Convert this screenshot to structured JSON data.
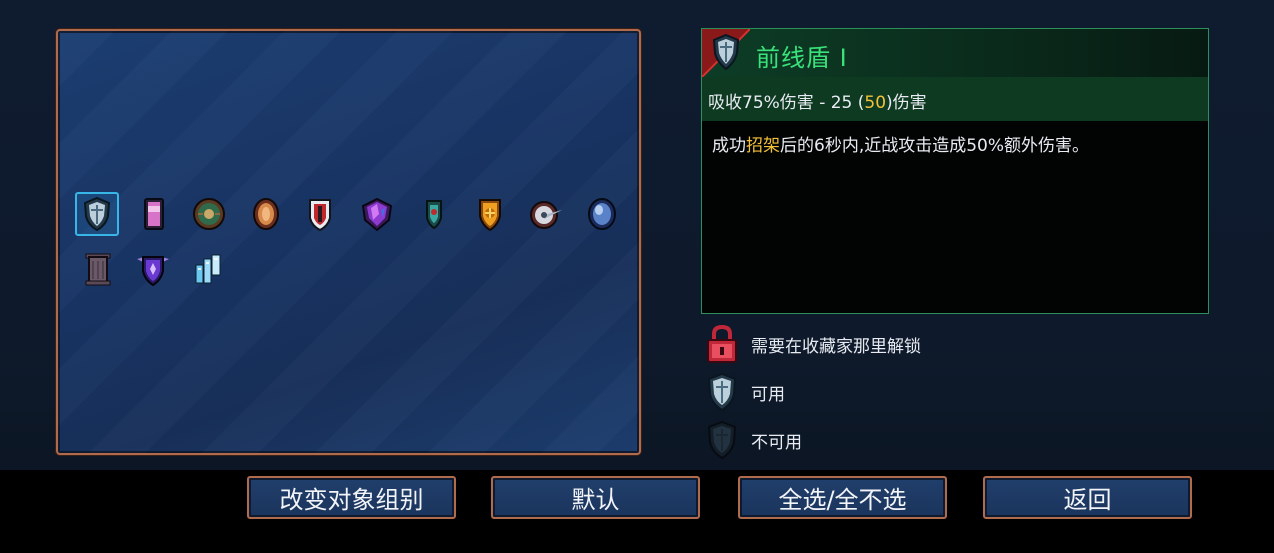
{
  "detail": {
    "name": "前线盾 I",
    "stat_prefix": "吸收75%伤害 - 25 (",
    "stat_highlight": "50",
    "stat_suffix": ")伤害",
    "desc_prefix": "成功",
    "desc_highlight": "招架",
    "desc_suffix": "后的6秒内,近战攻击造成50%额外伤害。",
    "colors": {
      "title": "#39e27a",
      "highlight": "#f3c13a",
      "panel_border": "#2f8f5a"
    }
  },
  "legend": {
    "locked": "需要在收藏家那里解锁",
    "available": "可用",
    "unavailable": "不可用"
  },
  "buttons": {
    "change_group": "改变对象组别",
    "default": "默认",
    "select_all": "全选/全不选",
    "back": "返回"
  },
  "items": [
    {
      "icon": "front-line-shield-icon",
      "selected": true
    },
    {
      "icon": "pink-banner-shield-icon",
      "selected": false
    },
    {
      "icon": "bronze-green-round-shield-icon",
      "selected": false
    },
    {
      "icon": "copper-oval-shield-icon",
      "selected": false
    },
    {
      "icon": "red-white-shield-icon",
      "selected": false
    },
    {
      "icon": "purple-crystal-shield-icon",
      "selected": false
    },
    {
      "icon": "teal-small-shield-icon",
      "selected": false
    },
    {
      "icon": "golden-shield-icon",
      "selected": false
    },
    {
      "icon": "spiked-round-shield-icon",
      "selected": false
    },
    {
      "icon": "blue-orb-shield-icon",
      "selected": false
    },
    {
      "icon": "stone-door-shield-icon",
      "selected": false
    },
    {
      "icon": "winged-purple-shield-icon",
      "selected": false
    },
    {
      "icon": "ice-shield-icon",
      "selected": false
    }
  ]
}
